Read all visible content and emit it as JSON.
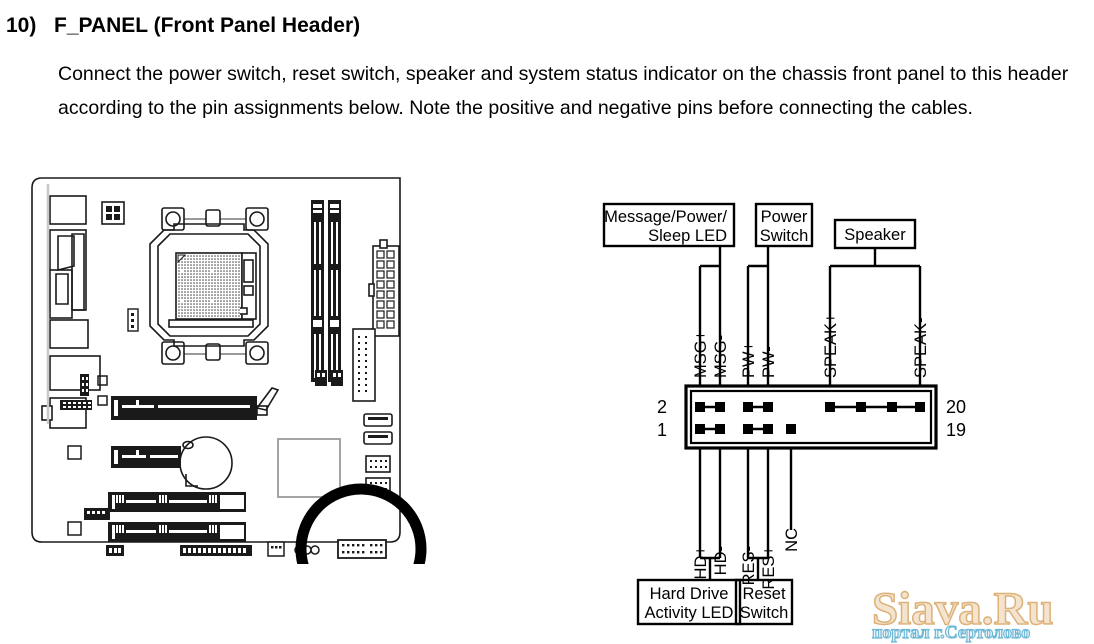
{
  "section": {
    "number": "10)",
    "title": "F_PANEL (Front Panel Header)",
    "body": "Connect the power switch, reset switch, speaker and system status indicator on the chassis front panel to this header according to the pin assignments below. Note the positive and negative pins before connecting the cables."
  },
  "figure": {
    "board_caption": "",
    "highlight_shape": "circle-callout"
  },
  "diagram": {
    "top_boxes": [
      {
        "id": "msg-led",
        "lines": [
          "Message/Power/",
          "Sleep LED"
        ]
      },
      {
        "id": "power-switch",
        "lines": [
          "Power",
          "Switch"
        ]
      },
      {
        "id": "speaker",
        "lines": [
          "Speaker"
        ]
      }
    ],
    "bottom_boxes": [
      {
        "id": "hdd-led",
        "lines": [
          "Hard Drive",
          "Activity LED"
        ]
      },
      {
        "id": "reset-switch",
        "lines": [
          "Reset",
          "Switch"
        ]
      }
    ],
    "top_pin_labels": [
      "MSG+",
      "MSG-",
      "PW+",
      "PW-",
      "SPEAK+",
      "SPEAK-"
    ],
    "bottom_pin_labels": [
      "HD+",
      "HD-",
      "RES-",
      "RES+",
      "NC"
    ],
    "pin_numbers": {
      "top_left": "2",
      "bottom_left": "1",
      "top_right": "20",
      "bottom_right": "19"
    }
  },
  "watermark": {
    "main": "Siava.Ru",
    "sub": "портал г.Сертолово",
    "main_color": "#dcb278",
    "sub_color": "#6fb9d6"
  }
}
